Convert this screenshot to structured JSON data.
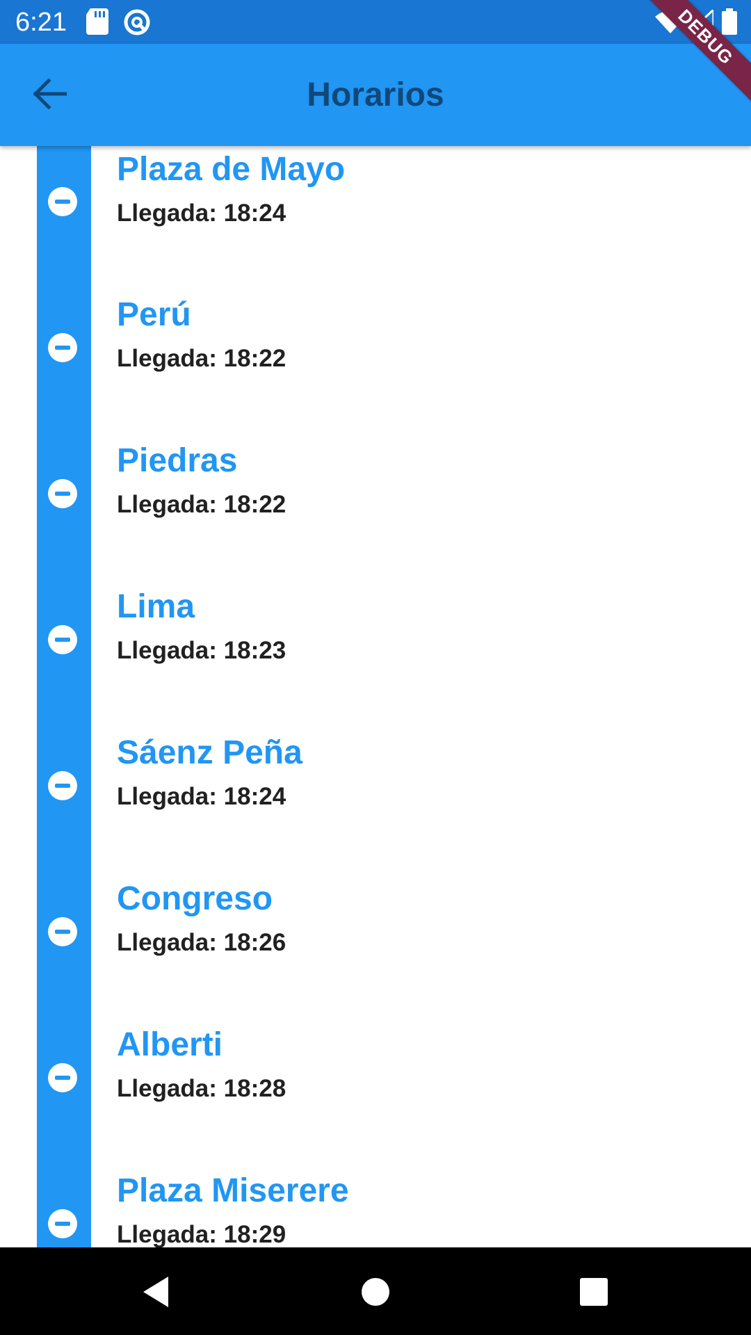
{
  "status_bar": {
    "time": "6:21",
    "left_icons": [
      "sd-card-icon",
      "no-disturb-icon"
    ],
    "right_icons": [
      "wifi-icon",
      "signal-icon",
      "battery-icon"
    ]
  },
  "debug_banner": {
    "label": "DEBUG",
    "color": "#7a2447"
  },
  "app_bar": {
    "title": "Horarios",
    "back_icon": "arrow-back-icon",
    "background": "#2196f3",
    "title_color": "#10487a"
  },
  "stops": [
    {
      "name": "Plaza de Mayo",
      "arrival": "Llegada: 18:24"
    },
    {
      "name": "Perú",
      "arrival": "Llegada: 18:22"
    },
    {
      "name": "Piedras",
      "arrival": "Llegada: 18:22"
    },
    {
      "name": "Lima",
      "arrival": "Llegada: 18:23"
    },
    {
      "name": "Sáenz Peña",
      "arrival": "Llegada: 18:24"
    },
    {
      "name": "Congreso",
      "arrival": "Llegada: 18:26"
    },
    {
      "name": "Alberti",
      "arrival": "Llegada: 18:28"
    },
    {
      "name": "Plaza Miserere",
      "arrival": "Llegada: 18:29"
    }
  ],
  "colors": {
    "accent": "#2196f3",
    "status_bar": "#1976d2",
    "arrival_text": "#212121"
  },
  "nav_bar": {
    "buttons": [
      "back-triangle-icon",
      "home-circle-icon",
      "recents-square-icon"
    ]
  }
}
